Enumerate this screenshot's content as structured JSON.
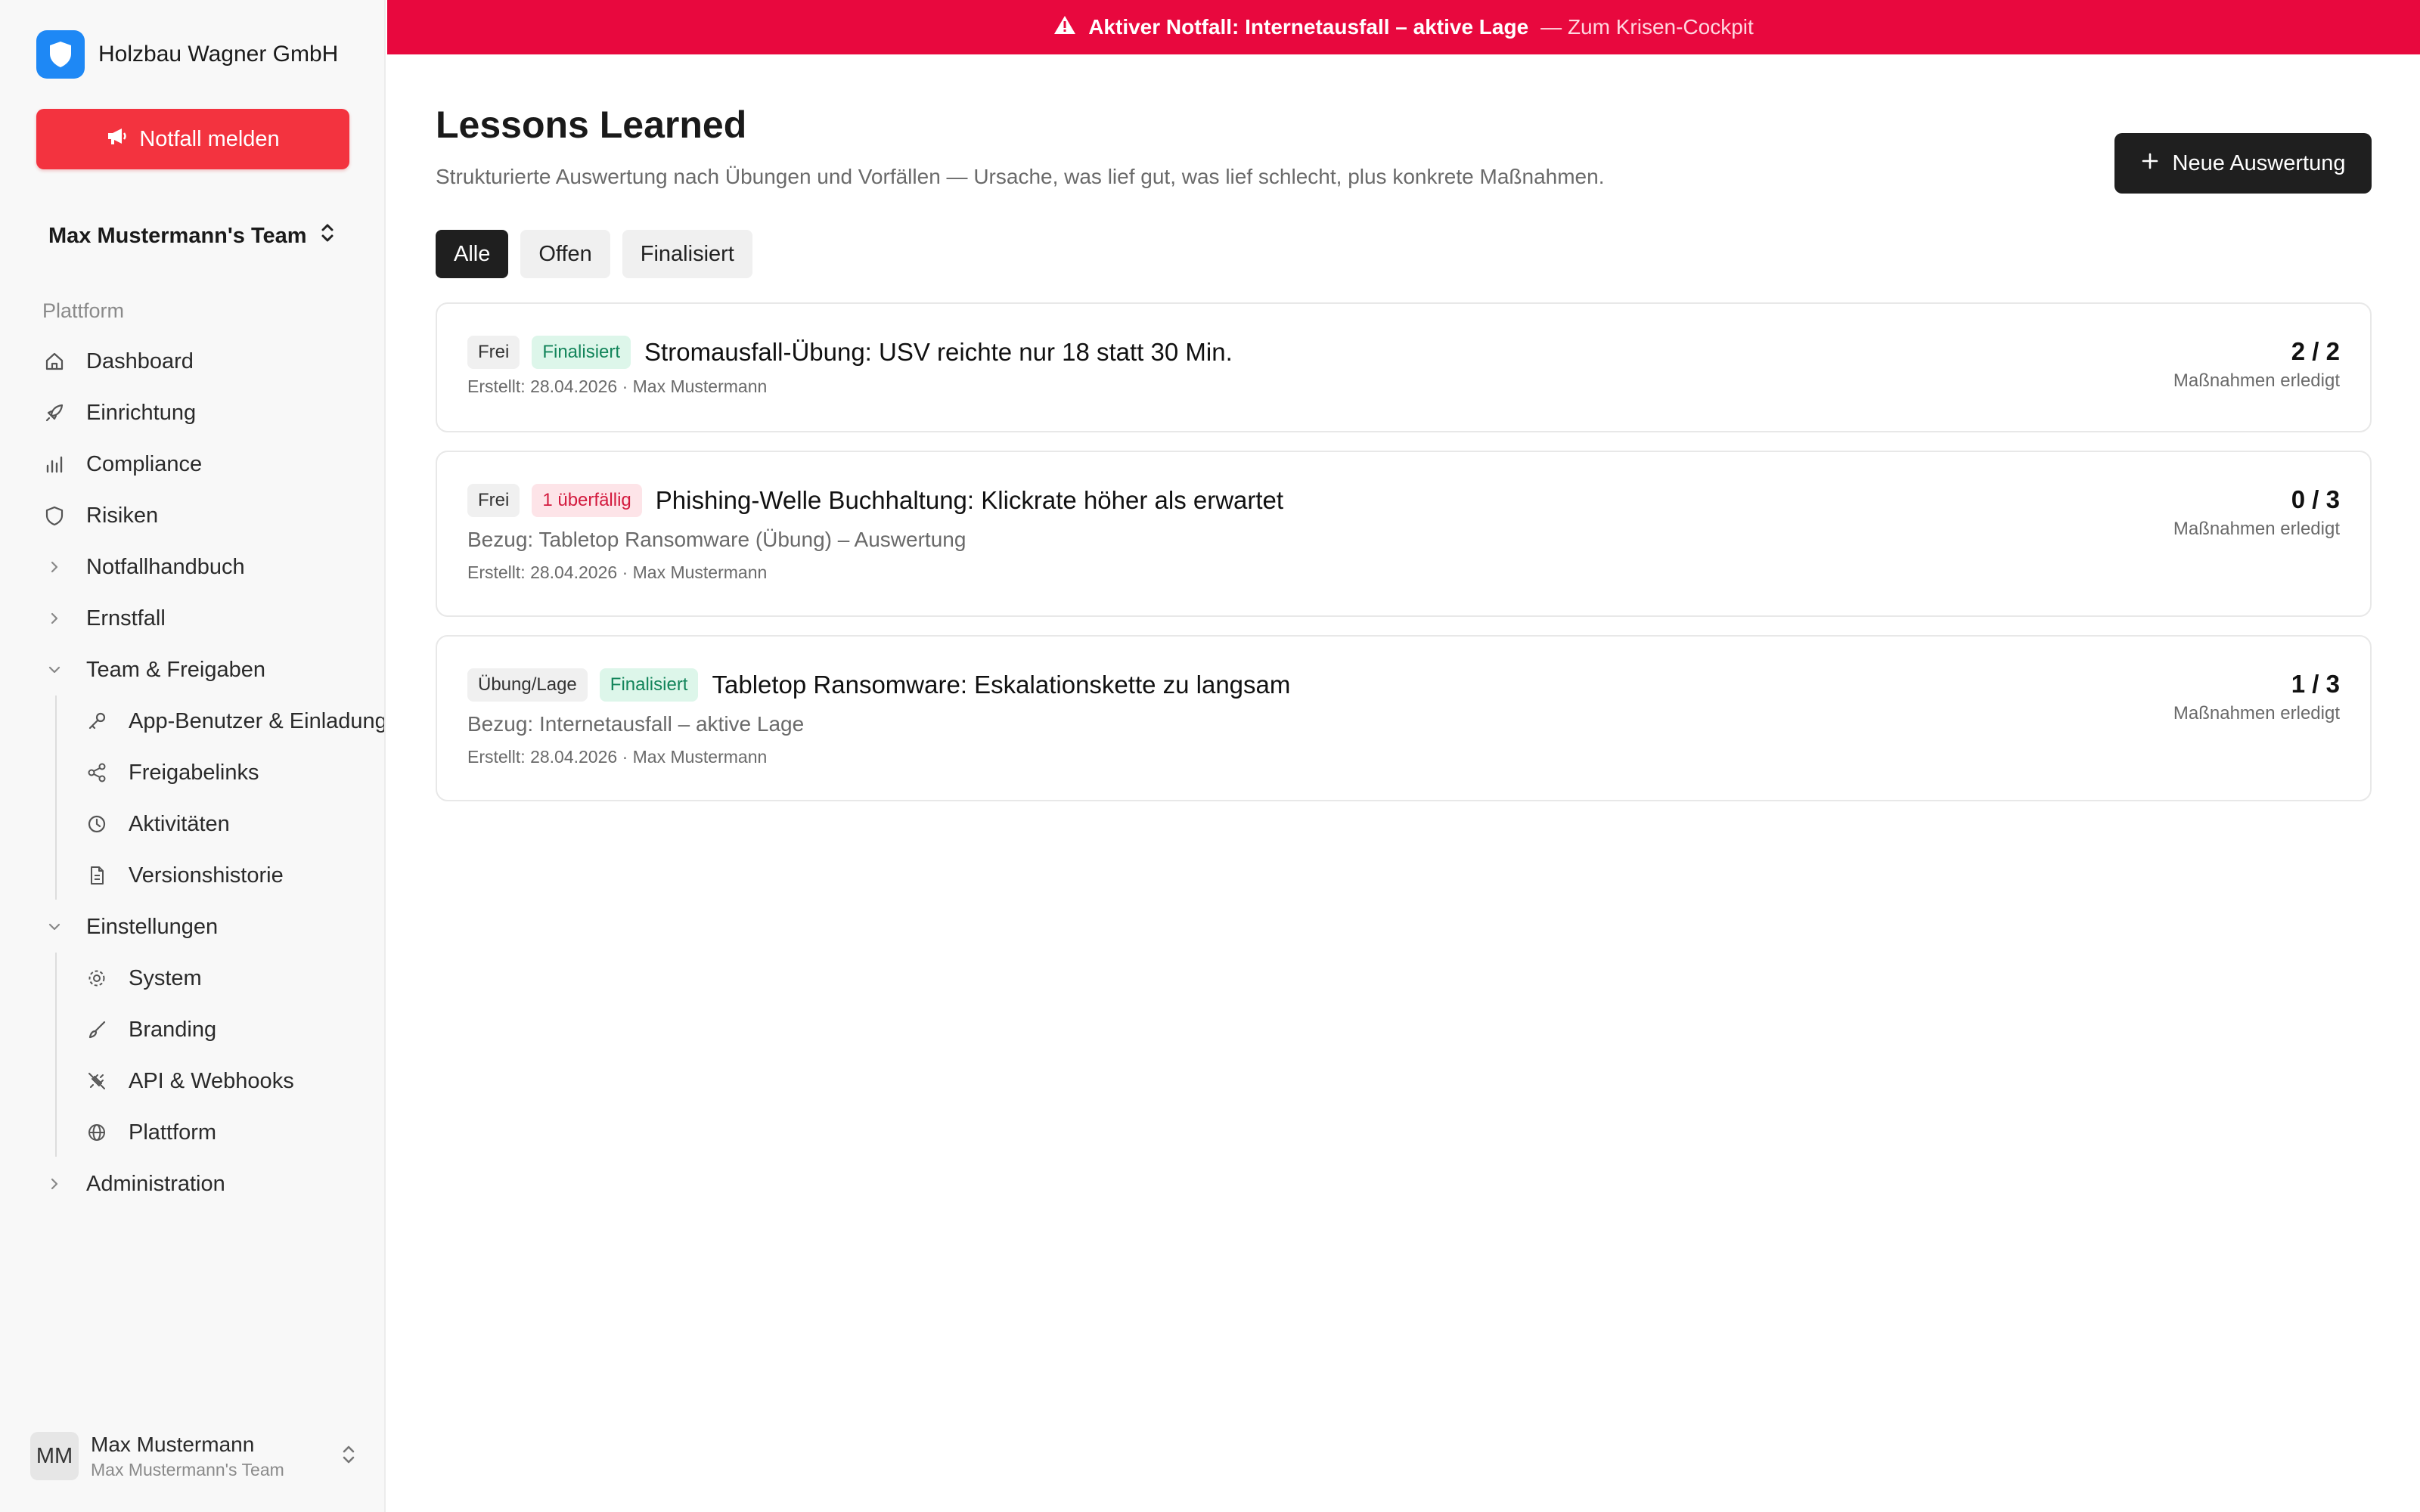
{
  "sidebar": {
    "org_name": "Holzbau Wagner GmbH",
    "emergency_label": "Notfall melden",
    "team_name": "Max Mustermann's Team",
    "group_label": "Plattform",
    "items": [
      {
        "label": "Dashboard",
        "icon": "home-icon"
      },
      {
        "label": "Einrichtung",
        "icon": "rocket-icon"
      },
      {
        "label": "Compliance",
        "icon": "bar-chart-icon"
      },
      {
        "label": "Risiken",
        "icon": "shield-icon"
      },
      {
        "label": "Notfallhandbuch",
        "icon": "chevron-right-icon"
      },
      {
        "label": "Ernstfall",
        "icon": "chevron-right-icon"
      },
      {
        "label": "Team & Freigaben",
        "icon": "chevron-down-icon"
      },
      {
        "label": "Einstellungen",
        "icon": "chevron-down-icon"
      },
      {
        "label": "Administration",
        "icon": "chevron-right-icon"
      }
    ],
    "team_sub": [
      {
        "label": "App-Benutzer & Einladungen",
        "icon": "key-icon"
      },
      {
        "label": "Freigabelinks",
        "icon": "share-icon"
      },
      {
        "label": "Aktivitäten",
        "icon": "clock-icon"
      },
      {
        "label": "Versionshistorie",
        "icon": "file-icon"
      }
    ],
    "settings_sub": [
      {
        "label": "System",
        "icon": "gear-icon"
      },
      {
        "label": "Branding",
        "icon": "brush-icon"
      },
      {
        "label": "API & Webhooks",
        "icon": "plug-icon"
      },
      {
        "label": "Plattform",
        "icon": "globe-icon"
      }
    ],
    "user": {
      "initials": "MM",
      "name": "Max Mustermann",
      "team": "Max Mustermann's Team"
    }
  },
  "banner": {
    "text": "Aktiver Notfall: Internetausfall – aktive Lage",
    "link": "— Zum Krisen-Cockpit"
  },
  "main": {
    "title": "Lessons Learned",
    "subtitle": "Strukturierte Auswertung nach Übungen und Vorfällen — Ursache, was lief gut, was lief schlecht, plus konkrete Maßnahmen.",
    "new_button": "Neue Auswertung",
    "tabs": [
      "Alle",
      "Offen",
      "Finalisiert"
    ],
    "count_label": "Maßnahmen erledigt",
    "cards": [
      {
        "type_badge": "Frei",
        "status_badge": "Finalisiert",
        "title": "Stromausfall-Übung: USV reichte nur 18 statt 30 Min.",
        "reference": "",
        "meta": "Erstellt: 28.04.2026 · Max Mustermann",
        "count": "2 / 2"
      },
      {
        "type_badge": "Frei",
        "status_badge": "1 überfällig",
        "title": "Phishing-Welle Buchhaltung: Klickrate höher als erwartet",
        "reference": "Bezug: Tabletop Ransomware (Übung) – Auswertung",
        "meta": "Erstellt: 28.04.2026 · Max Mustermann",
        "count": "0 / 3"
      },
      {
        "type_badge": "Übung/Lage",
        "status_badge": "Finalisiert",
        "title": "Tabletop Ransomware: Eskalationskette zu langsam",
        "reference": "Bezug: Internetausfall – aktive Lage",
        "meta": "Erstellt: 28.04.2026 · Max Mustermann",
        "count": "1 / 3"
      }
    ]
  },
  "colors": {
    "banner": "#e8083e",
    "emergency": "#f3333f",
    "accent_blue": "#1e88f5",
    "success": "#12845a",
    "danger": "#d31a3e"
  }
}
